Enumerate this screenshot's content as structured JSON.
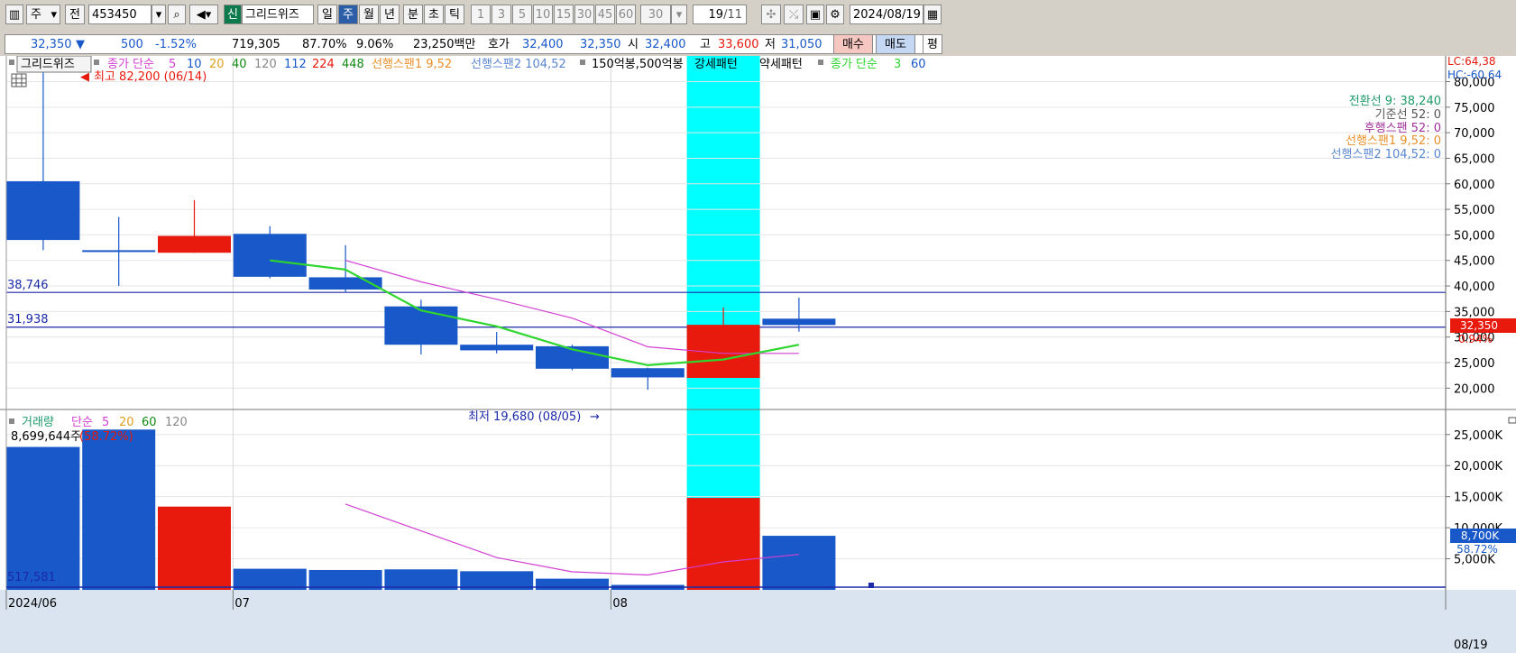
{
  "toolbar": {
    "period_select": "주",
    "prev_label": "전",
    "code": "453450",
    "new_badge": "신",
    "name": "그리드위즈",
    "periods": [
      "일",
      "주",
      "월",
      "년"
    ],
    "period_selected": "주",
    "intraday": [
      "분",
      "초",
      "틱"
    ],
    "minutes": [
      "1",
      "3",
      "5",
      "10",
      "15",
      "30",
      "45",
      "60"
    ],
    "minute_select": "30",
    "count": "19",
    "count_total": "/11",
    "date": "2024/08/19"
  },
  "quote": {
    "price": "32,350",
    "direction": "▼",
    "change": "500",
    "change_pct": "-1.52%",
    "volume": "719,305",
    "vol_ratio": "87.70%",
    "turnover": "9.06%",
    "amount": "23,250백만",
    "bid_label": "호가",
    "bid1": "32,400",
    "bid2": "32,350",
    "open_label": "시",
    "open": "32,400",
    "high_label": "고",
    "high": "33,600",
    "low_label": "저",
    "low": "31,050",
    "buy_label": "매수",
    "sell_label": "매도",
    "eval_label": "평"
  },
  "price_legend": {
    "name": "그리드위즈",
    "ma_label": "종가 단순",
    "ma_periods": [
      "5",
      "10",
      "20",
      "40",
      "120",
      "112",
      "224",
      "448"
    ],
    "span1": "선행스팬1 9,52",
    "span2": "선행스팬2 104,52",
    "pattern": "150억봉,500억봉",
    "strong": "강세패턴",
    "weak": "약세패턴",
    "ma2_label": "종가 단순",
    "ma2_periods": [
      "3",
      "60"
    ]
  },
  "right_legend": {
    "lc": "LC:64,38",
    "hc": "HC:-60,64",
    "conversion": "전환선 9: 38,240",
    "base": "기준선 52: 0",
    "lagging": "후행스팬 52: 0",
    "lead1": "선행스팬1 9,52: 0",
    "lead2": "선행스팬2 104,52: 0"
  },
  "annotations": {
    "high": "최고 82,200 (06/14)",
    "low": "최저 19,680 (08/05)",
    "hline1": "38,746",
    "hline2": "31,938",
    "current_price": "32,350",
    "current_pct": "0.94%"
  },
  "volume_legend": {
    "label": "거래량",
    "ma_label": "단순",
    "periods": [
      "5",
      "20",
      "60",
      "120"
    ],
    "max_value": "8,699,644주",
    "max_pct": "(58.72%)",
    "min_value": "517,581",
    "current": "8,700K",
    "current_pct": "58.72%"
  },
  "xaxis": {
    "labels": [
      "2024/06",
      "07",
      "08"
    ],
    "last": "08/19"
  },
  "colors": {
    "up": "#e8190d",
    "down": "#1858c8",
    "highlight": "#00ffff",
    "ma5": "#d23fd2",
    "ma3": "#2ed62e"
  },
  "chart_data": {
    "type": "candlestick",
    "price_axis": {
      "ticks": [
        "20,000",
        "25,000",
        "30,000",
        "35,000",
        "40,000",
        "45,000",
        "50,000",
        "55,000",
        "60,000",
        "65,000",
        "70,000",
        "75,000",
        "80,000"
      ],
      "ylim": [
        16000,
        81500
      ]
    },
    "volume_axis": {
      "ticks": [
        "5,000K",
        "10,000K",
        "15,000K",
        "20,000K",
        "25,000K"
      ],
      "ylim": [
        0,
        27000
      ]
    },
    "candles": [
      {
        "open": 60500,
        "high": 82200,
        "low": 47000,
        "close": 49000,
        "volume": 23000
      },
      {
        "open": 47000,
        "high": 53500,
        "low": 40000,
        "close": 46800,
        "volume": 25800
      },
      {
        "open": 46500,
        "high": 56800,
        "low": 46500,
        "close": 49800,
        "volume": 13400
      },
      {
        "open": 50200,
        "high": 51700,
        "low": 41500,
        "close": 41800,
        "volume": 3400
      },
      {
        "open": 41700,
        "high": 48000,
        "low": 38700,
        "close": 39300,
        "volume": 3200
      },
      {
        "open": 36000,
        "high": 37300,
        "low": 26600,
        "close": 28500,
        "volume": 3300
      },
      {
        "open": 28500,
        "high": 31000,
        "low": 26800,
        "close": 27400,
        "volume": 3000
      },
      {
        "open": 28200,
        "high": 28500,
        "low": 23500,
        "close": 23800,
        "volume": 1800
      },
      {
        "open": 23900,
        "high": 24000,
        "low": 19680,
        "close": 22100,
        "volume": 800
      },
      {
        "open": 22000,
        "high": 35800,
        "low": 22000,
        "close": 32400,
        "volume": 14800
      },
      {
        "open": 33600,
        "high": 37700,
        "low": 31050,
        "close": 32350,
        "volume": 8700
      }
    ],
    "ma5": [
      null,
      null,
      null,
      null,
      45000,
      40800,
      37400,
      33700,
      28100,
      26800,
      26800
    ],
    "ma3": [
      null,
      null,
      null,
      45000,
      43200,
      35200,
      32100,
      27600,
      24500,
      25600,
      28500
    ],
    "vol_ma5": [
      null,
      null,
      null,
      null,
      13800,
      9500,
      5200,
      2900,
      2400,
      4500,
      5700
    ],
    "lines": [
      38746,
      31938
    ],
    "highlight_index": 9,
    "x_labels": [
      {
        "index": 0,
        "label": "2024/06"
      },
      {
        "index": 3,
        "label": "07"
      },
      {
        "index": 8,
        "label": "08"
      }
    ]
  }
}
